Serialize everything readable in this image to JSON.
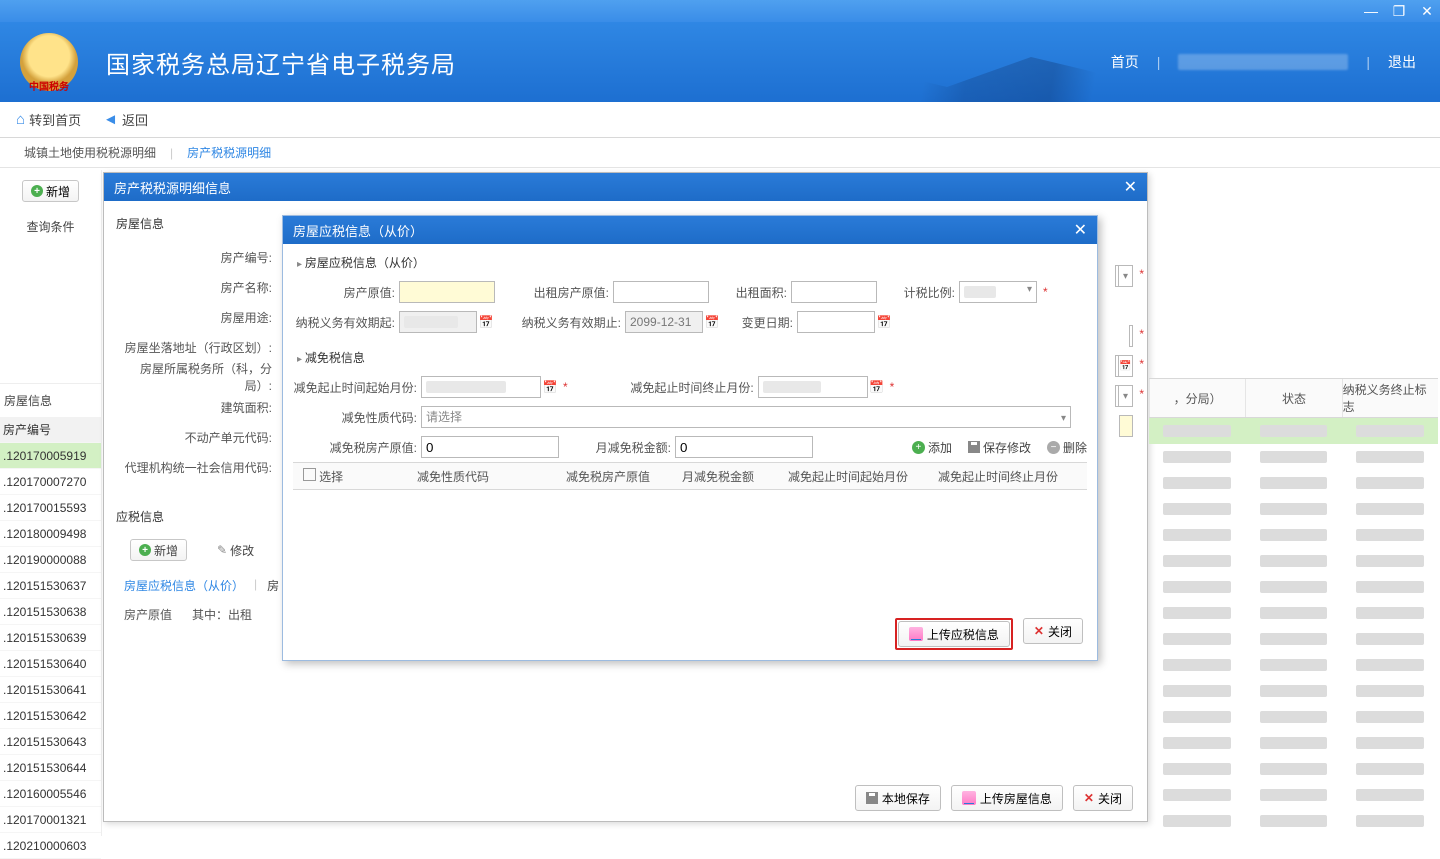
{
  "app": {
    "title": "国家税务总局辽宁省电子税务局"
  },
  "header": {
    "home": "首页",
    "logout": "退出"
  },
  "nav": {
    "goHome": "转到首页",
    "back": "返回"
  },
  "tabs": {
    "t1": "城镇土地使用税税源明细",
    "t2": "房产税税源明细"
  },
  "left": {
    "add": "新增",
    "query": "查询条件",
    "houseInfo": "房屋信息",
    "idHdr": "房产编号",
    "ids": [
      ".120170005919",
      ".120170007270",
      ".120170015593",
      ".120180009498",
      ".120190000088",
      ".120151530637",
      ".120151530638",
      ".120151530639",
      ".120151530640",
      ".120151530641",
      ".120151530642",
      ".120151530643",
      ".120151530644",
      ".120160005546",
      ".120170001321",
      ".120210000603"
    ]
  },
  "dlg1": {
    "title": "房产税税源明细信息",
    "group": "房屋信息",
    "labels": {
      "fcbh": "房产编号:",
      "fcmc": "房产名称:",
      "fwyt": "房屋用途:",
      "addr": "房屋坐落地址（行政区划）:",
      "swjg": "房屋所属税务所（科，分局）:",
      "jzmj": "建筑面积:",
      "bdc": "不动产单元代码:",
      "xydm": "代理机构统一社会信用代码:"
    },
    "taxSection": "应税信息",
    "add": "新增",
    "edit": "修改",
    "subtabs": {
      "a": "房屋应税信息（从价）",
      "b": "房"
    },
    "row2": {
      "a": "房产原值",
      "b": "其中：出租"
    },
    "footer": {
      "saveLocal": "本地保存",
      "upload": "上传房屋信息",
      "close": "关闭"
    }
  },
  "dlg2": {
    "title": "房屋应税信息（从价）",
    "sect1": "房屋应税信息（从价）",
    "sect2": "减免税信息",
    "labels": {
      "fcyz": "房产原值:",
      "czfcyz": "出租房产原值:",
      "czmj": "出租面积:",
      "jsbl": "计税比例:",
      "nsqsfrom": "纳税义务有效期起:",
      "nsqsend": "纳税义务有效期止:",
      "nsqsendV": "2099-12-31",
      "bgrq": "变更日期:",
      "jmStart": "减免起止时间起始月份:",
      "jmEnd": "减免起止时间终止月份:",
      "jmxz": "减免性质代码:",
      "jmxzPh": "请选择",
      "jmfcyz": "减免税房产原值:",
      "jmfcyzV": "0",
      "yjmje": "月减免税金额:",
      "yjmjeV": "0"
    },
    "actions": {
      "add": "添加",
      "save": "保存修改",
      "del": "删除"
    },
    "tbl": {
      "sel": "选择",
      "c1": "减免性质代码",
      "c2": "减免税房产原值",
      "c3": "月减免税金额",
      "c4": "减免起止时间起始月份",
      "c5": "减免起止时间终止月份"
    },
    "footer": {
      "upload": "上传应税信息",
      "close": "关闭"
    }
  },
  "right": {
    "hdr": {
      "h1": "，分局）",
      "h2": "状态",
      "h3": "纳税义务终止标志"
    },
    "rows": 16
  }
}
